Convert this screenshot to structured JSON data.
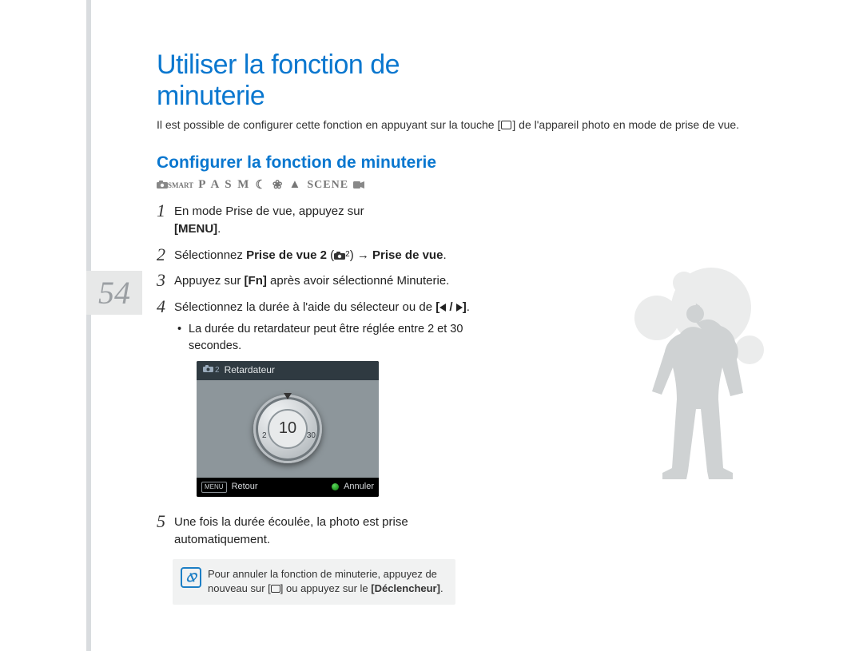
{
  "page_number": "54",
  "title": "Utiliser la fonction de minuterie",
  "intro_before_icon": "Il est possible de configurer cette fonction en appuyant sur la touche [",
  "intro_after_icon": "] de l'appareil photo en mode de prise de vue.",
  "subhead": "Configurer la fonction de minuterie",
  "mode_symbols": {
    "smart_label": "SMART",
    "letters": "P A S M",
    "scene_label": "SCENE"
  },
  "steps": {
    "s1_a": "En mode Prise de vue, appuyez sur ",
    "s1_menu": "[MENU]",
    "s1_b": ".",
    "s2_a": "Sélectionnez ",
    "s2_bold1": "Prise de vue 2",
    "s2_paren_open": " (",
    "s2_icon_num": "2",
    "s2_paren_close": ")",
    "s2_arrow": "  →  ",
    "s2_bold2": "Prise de vue",
    "s2_c": ".",
    "s3_a": "Appuyez sur ",
    "s3_fn": "[Fn]",
    "s3_b": " après avoir sélectionné Minuterie.",
    "s4_a": "Sélectionnez la durée à l'aide du sélecteur ou de ",
    "s4_bracket_open": "[",
    "s4_sep": " / ",
    "s4_bracket_close": "]",
    "s4_c": ".",
    "s4_bullet": "La durée du retardateur peut être réglée entre 2 et 30 secondes.",
    "s5": "Une fois la durée écoulée, la photo est prise automatiquement."
  },
  "lcd": {
    "top_label": "Retardateur",
    "top_icon_num": "2",
    "dial_value": "10",
    "dial_min": "2",
    "dial_max": "30",
    "menu_chip": "MENU",
    "retour": "Retour",
    "annuler": "Annuler"
  },
  "note": {
    "line1_a": "Pour annuler la fonction de minuterie, appuyez de nouveau sur [",
    "line1_b": "] ou appuyez sur le ",
    "declencheur": "[Déclencheur]",
    "line1_c": "."
  }
}
